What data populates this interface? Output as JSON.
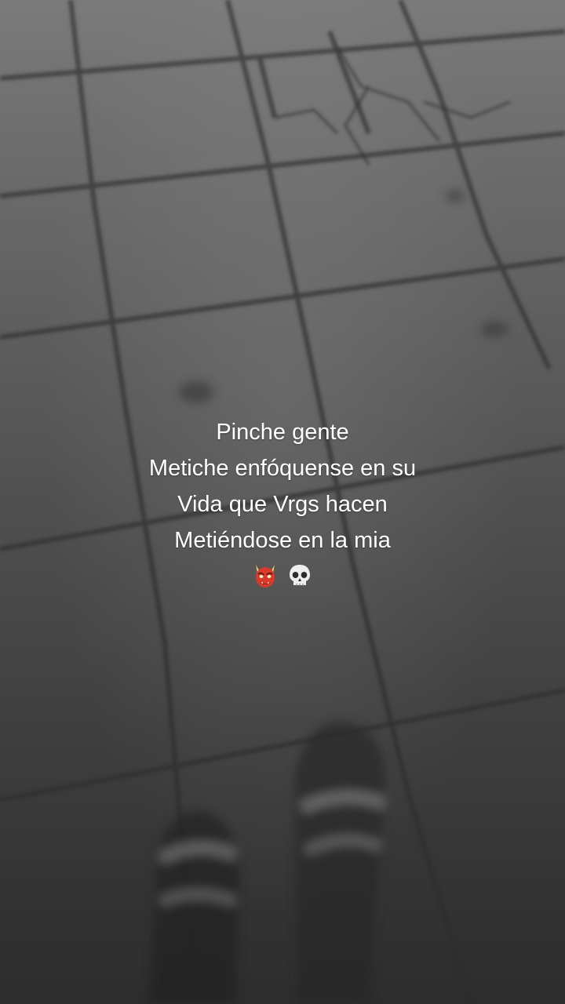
{
  "caption": {
    "lines": [
      "Pinche gente",
      "Metiche enfóquense en su",
      "Vida que Vrgs hacen",
      "Metiéndose en la mia"
    ],
    "emojis": [
      "devil-mask-icon",
      "skull-icon"
    ]
  },
  "colors": {
    "text": "#ffffff",
    "ground": "#5f5f5f"
  }
}
